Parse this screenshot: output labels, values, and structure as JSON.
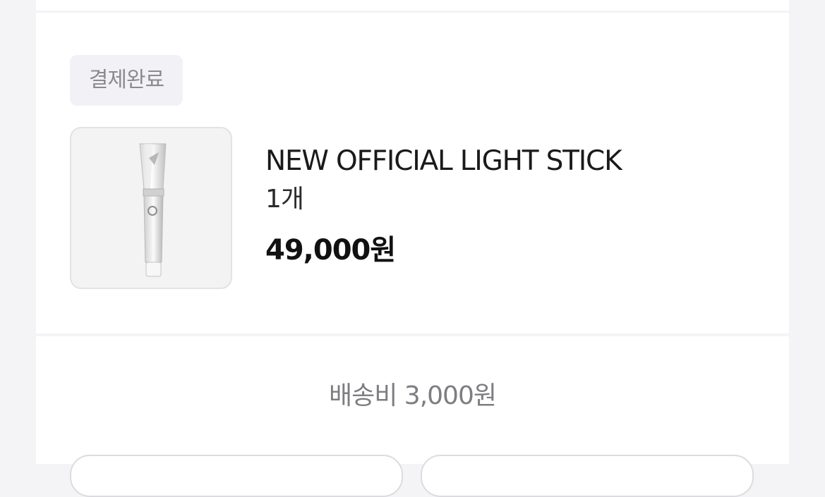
{
  "order": {
    "status_badge": "결제완료",
    "product": {
      "name": "NEW OFFICIAL LIGHT STICK",
      "quantity": "1개",
      "price": "49,000원",
      "image_icon": "light-stick-image"
    }
  },
  "shipping": {
    "fee_text": "배송비 3,000원"
  },
  "colors": {
    "page_background": "#f4f4f7",
    "card_background": "#ffffff",
    "badge_background": "#f2f2f6",
    "badge_text": "#8a8a90",
    "primary_text": "#111111",
    "secondary_text": "#7d7d82"
  }
}
